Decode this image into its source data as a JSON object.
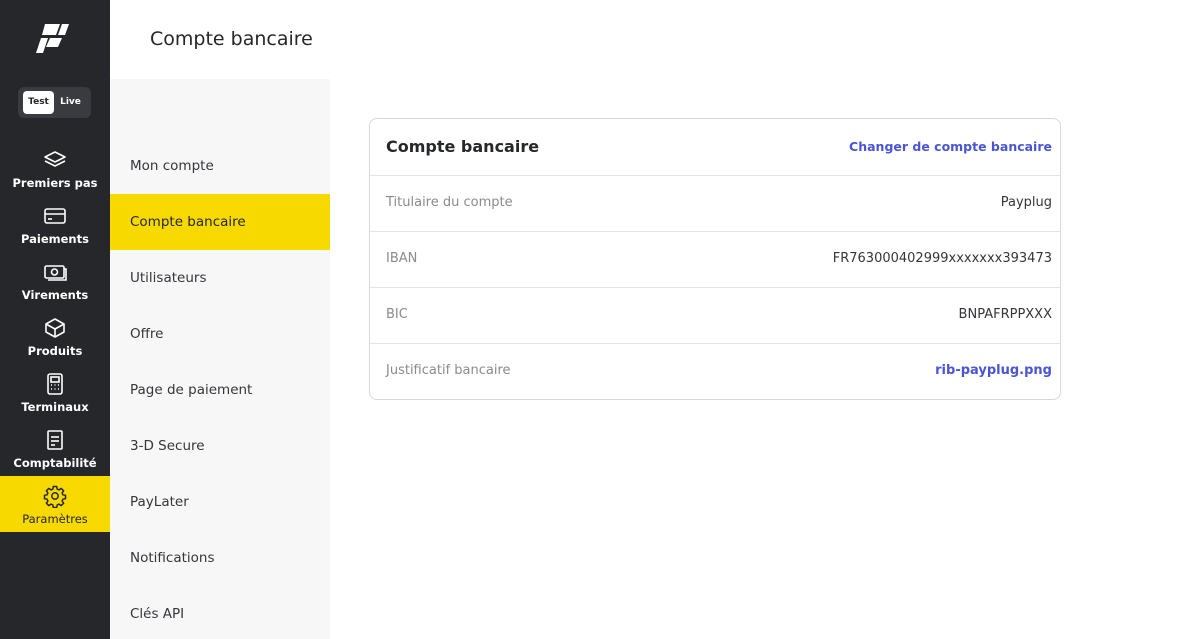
{
  "header": {
    "title": "Compte bancaire"
  },
  "mode_toggle": {
    "test_label": "Test",
    "live_label": "Live",
    "selected": "Test"
  },
  "sidebar": {
    "items": [
      {
        "label": "Premiers pas",
        "icon": "layers-icon"
      },
      {
        "label": "Paiements",
        "icon": "credit-card-icon"
      },
      {
        "label": "Virements",
        "icon": "banknote-icon"
      },
      {
        "label": "Produits",
        "icon": "box-icon"
      },
      {
        "label": "Terminaux",
        "icon": "payment-terminal-icon"
      },
      {
        "label": "Comptabilité",
        "icon": "receipt-icon"
      },
      {
        "label": "Paramètres",
        "icon": "gear-icon",
        "active": true
      }
    ]
  },
  "submenu": {
    "items": [
      {
        "label": "Mon compte"
      },
      {
        "label": "Compte bancaire",
        "active": true
      },
      {
        "label": "Utilisateurs"
      },
      {
        "label": "Offre"
      },
      {
        "label": "Page de paiement"
      },
      {
        "label": "3-D Secure"
      },
      {
        "label": "PayLater"
      },
      {
        "label": "Notifications"
      },
      {
        "label": "Clés API"
      }
    ]
  },
  "card": {
    "title": "Compte bancaire",
    "action_label": "Changer de compte bancaire",
    "rows": [
      {
        "label": "Titulaire du compte",
        "value": "Payplug"
      },
      {
        "label": "IBAN",
        "value": "FR763000402999xxxxxxx393473"
      },
      {
        "label": "BIC",
        "value": "BNPAFRPPXXX"
      },
      {
        "label": "Justificatif bancaire",
        "value": "rib-payplug.png",
        "is_link": true
      }
    ]
  },
  "colors": {
    "sidebar_bg": "#26272b",
    "accent": "#f7d900",
    "link": "#4a55d4",
    "submenu_bg": "#f7f7f7"
  }
}
